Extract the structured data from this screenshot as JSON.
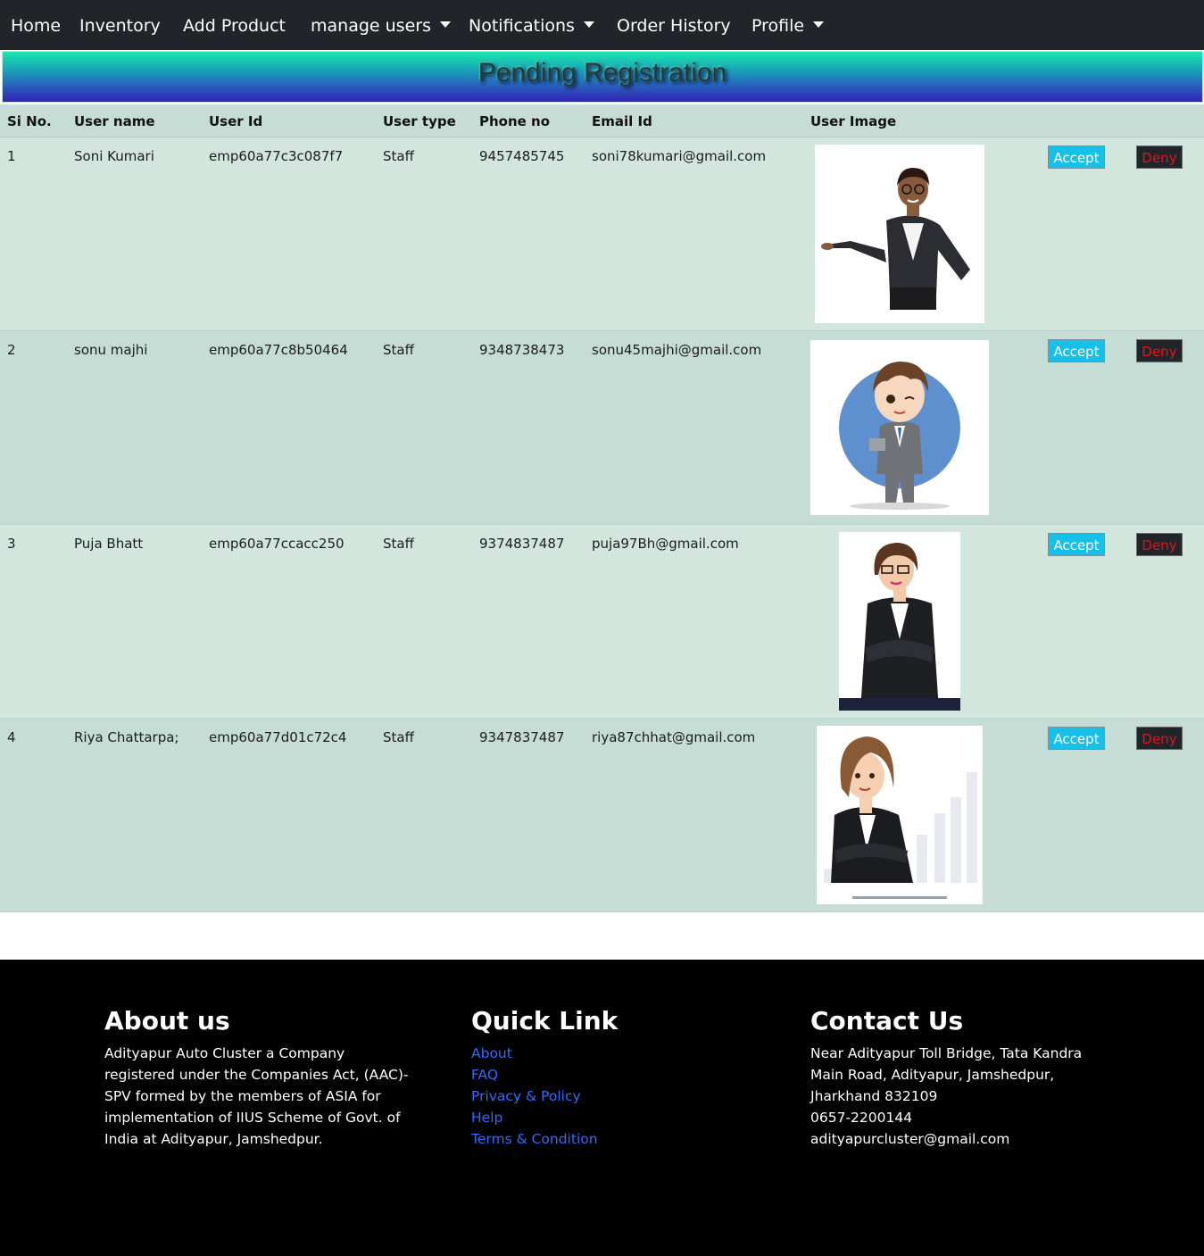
{
  "nav": {
    "home": "Home",
    "inventory": "Inventory",
    "add_product": "Add Product",
    "manage_users": "manage users",
    "notifications": "Notifications",
    "order_history": "Order History",
    "profile": "Profile"
  },
  "banner": {
    "title": "Pending Registration"
  },
  "table": {
    "headers": [
      "Si No.",
      "User name",
      "User Id",
      "User type",
      "Phone no",
      "Email Id",
      "User Image"
    ],
    "rows": [
      {
        "sno": "1",
        "name": "Soni Kumari",
        "id": "emp60a77c3c087f7",
        "type": "Staff",
        "phone": "9457485745",
        "email": "soni78kumari@gmail.com",
        "accept": "Accept",
        "deny": "Deny"
      },
      {
        "sno": "2",
        "name": "sonu majhi",
        "id": "emp60a77c8b50464",
        "type": "Staff",
        "phone": "9348738473",
        "email": "sonu45majhi@gmail.com",
        "accept": "Accept",
        "deny": "Deny"
      },
      {
        "sno": "3",
        "name": "Puja Bhatt",
        "id": "emp60a77ccacc250",
        "type": "Staff",
        "phone": "9374837487",
        "email": "puja97Bh@gmail.com",
        "accept": "Accept",
        "deny": "Deny"
      },
      {
        "sno": "4",
        "name": "Riya Chattarpa;",
        "id": "emp60a77d01c72c4",
        "type": "Staff",
        "phone": "9347837487",
        "email": "riya87chhat@gmail.com",
        "accept": "Accept",
        "deny": "Deny"
      }
    ]
  },
  "footer": {
    "about_title": "About us",
    "about_text": "Adityapur Auto Cluster a Company registered under the Companies Act, (AAC)-SPV formed by the members of ASIA for implementation of IIUS Scheme of Govt. of India at Adityapur, Jamshedpur.",
    "links_title": "Quick Link",
    "links": [
      "About",
      "FAQ",
      "Privacy & Policy",
      "Help",
      "Terms & Condition"
    ],
    "contact_title": "Contact Us",
    "address": "Near Adityapur Toll Bridge, Tata Kandra Main Road, Adityapur, Jamshedpur, Jharkhand 832109",
    "phone": "0657-2200144",
    "email": "adityapurcluster@gmail.com"
  },
  "colors": {
    "navbar": "#212529",
    "accept": "#17c0e9",
    "deny_text": "#e0141c",
    "link": "#2f6bff"
  }
}
